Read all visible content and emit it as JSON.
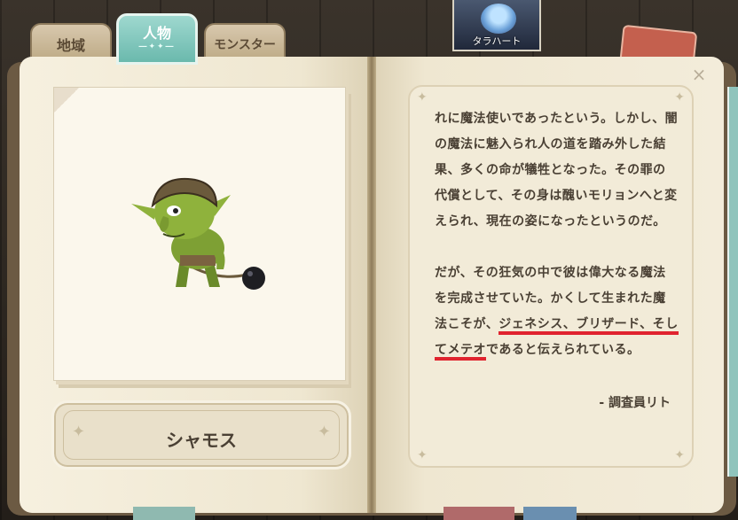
{
  "tabs": {
    "region": "地域",
    "character": "人物",
    "monster": "モンスター"
  },
  "portrait": {
    "name": "タラハート"
  },
  "close": "×",
  "subject": {
    "name": "シャモス"
  },
  "story": {
    "para1": "れに魔法使いであったという。しかし、闇の魔法に魅入られ人の道を踏み外した結果、多くの命が犠牲となった。その罪の代償として、その身は醜いモリョンへと変えられ、現在の姿になったというのだ。",
    "para2_a": "だが、その狂気の中で彼は偉大なる魔法を完成させていた。かくして生まれた魔法こそが、",
    "para2_underlined_1": "ジェネシス、ブリザード、そ",
    "para2_underlined_2": "してメテオ",
    "para2_b": "であると伝えられている。",
    "signature": "- 調査員リト"
  },
  "colors": {
    "active_tab": "#7cc4b8",
    "underline": "#e0232e",
    "page": "#f3ecda"
  }
}
